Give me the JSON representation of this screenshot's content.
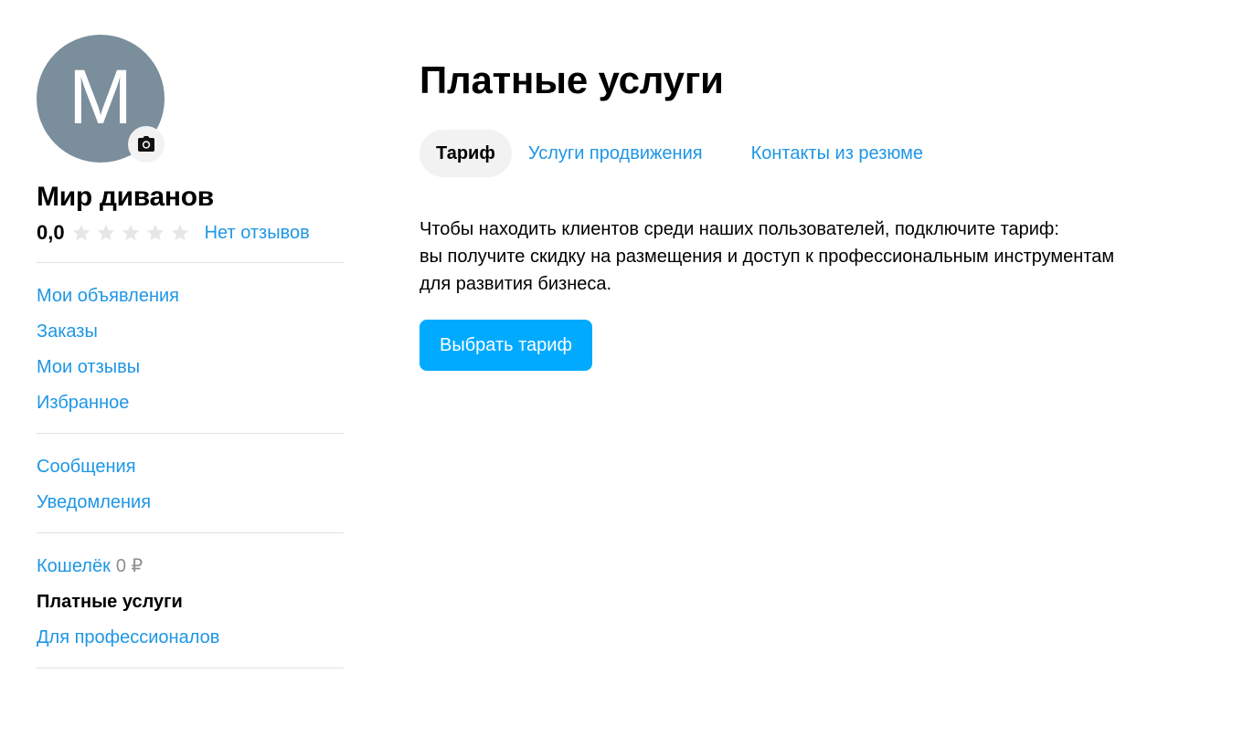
{
  "profile": {
    "avatar_letter": "М",
    "avatar_color": "#7a8e9c",
    "camera_icon": "camera-icon",
    "name": "Мир диванов",
    "rating_value": "0,0",
    "rating_stars_filled": 0,
    "rating_stars_total": 5,
    "reviews_label": "Нет отзывов"
  },
  "sidebar": {
    "group1": [
      {
        "label": "Мои объявления"
      },
      {
        "label": "Заказы"
      },
      {
        "label": "Мои отзывы"
      },
      {
        "label": "Избранное"
      }
    ],
    "group2": [
      {
        "label": "Сообщения"
      },
      {
        "label": "Уведомления"
      }
    ],
    "group3": {
      "wallet_label": "Кошелёк",
      "wallet_amount": "0 ₽",
      "paid_services_label": "Платные услуги",
      "pro_label": "Для профессионалов"
    }
  },
  "main": {
    "title": "Платные услуги",
    "tabs": [
      {
        "label": "Тариф",
        "active": true
      },
      {
        "label": "Услуги продвижения",
        "active": false
      },
      {
        "label": "Контакты из резюме",
        "active": false
      }
    ],
    "description_lines": [
      "Чтобы находить клиентов среди наших пользователей, подключите тариф:",
      "вы получите скидку на размещения и доступ к профессиональным инструментам",
      "для развития бизнеса."
    ],
    "cta_label": "Выбрать тариф"
  },
  "colors": {
    "link": "#1e96e6",
    "cta": "#00aaff",
    "active_tab_bg": "#f2f2f2",
    "divider": "#e1e1e1",
    "star_empty": "#e6e6e6",
    "muted": "#8f8f8f"
  }
}
